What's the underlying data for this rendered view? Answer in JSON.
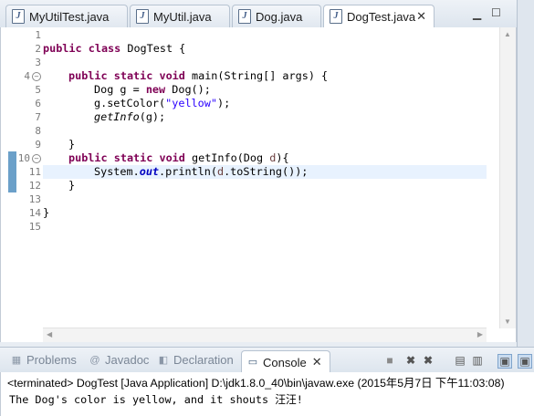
{
  "editor_tabs": [
    {
      "label": "MyUtilTest.java",
      "icon": "java-file-icon"
    },
    {
      "label": "MyUtil.java",
      "icon": "java-file-icon"
    },
    {
      "label": "Dog.java",
      "icon": "java-file-icon"
    },
    {
      "label": "DogTest.java",
      "icon": "java-file-icon",
      "active": true,
      "close": "✕"
    }
  ],
  "line_numbers": [
    "1",
    "2",
    "3",
    "4",
    "5",
    "6",
    "7",
    "8",
    "9",
    "10",
    "11",
    "12",
    "13",
    "14",
    "15"
  ],
  "code": {
    "l2_kw1": "public",
    "l2_kw2": "class",
    "l2_name": " DogTest {",
    "l4_kw1": "public",
    "l4_kw2": "static",
    "l4_kw3": "void",
    "l4_rest": " main(String[] args) {",
    "l5_a": "Dog g = ",
    "l5_kw": "new",
    "l5_b": " Dog();",
    "l6_a": "g.setColor(",
    "l6_str": "\"yellow\"",
    "l6_b": ");",
    "l7_call": "getInfo",
    "l7_rest": "(g);",
    "l9": "}",
    "l10_kw1": "public",
    "l10_kw2": "static",
    "l10_kw3": "void",
    "l10_a": " getInfo(Dog ",
    "l10_var": "d",
    "l10_b": "){",
    "l11_a": "System.",
    "l11_fld": "out",
    "l11_b": ".println(",
    "l11_var": "d",
    "l11_c": ".toString());",
    "l12": "}",
    "l14": "}"
  },
  "console_tabs": [
    {
      "label": "Problems",
      "icon": "problems-icon"
    },
    {
      "label": "Javadoc",
      "icon": "javadoc-icon"
    },
    {
      "label": "Declaration",
      "icon": "declaration-icon"
    },
    {
      "label": "Console",
      "icon": "console-icon",
      "active": true,
      "close": "✕"
    }
  ],
  "console": {
    "status": "<terminated> DogTest [Java Application] D:\\jdk1.8.0_40\\bin\\javaw.exe (2015年5月7日 下午11:03:08)",
    "output": "The Dog's color is yellow, and it shouts 汪汪!"
  },
  "colors": {
    "keyword": "#7f0055",
    "string": "#2a00ff",
    "field": "#0000c0",
    "highlight": "#e8f2fe",
    "marker": "#6ba0c9"
  }
}
